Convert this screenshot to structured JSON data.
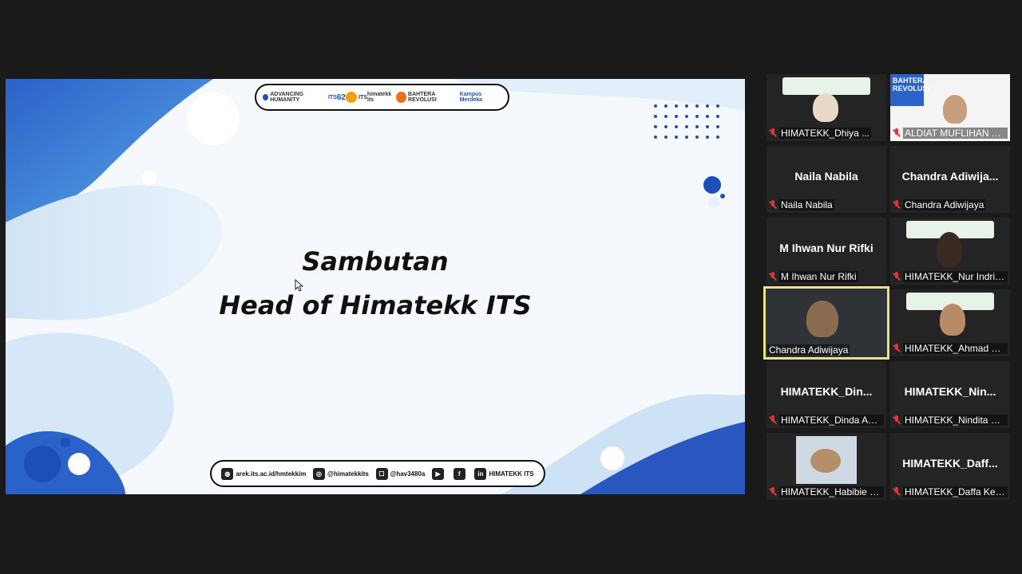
{
  "slide": {
    "title_line1": "Sambutan",
    "title_line2": "Head of Himatekk ITS",
    "logos": [
      "ADVANCING HUMANITY",
      "ITS",
      "62",
      "ITS",
      "himatekk its",
      "BAHTERA REVOLUSI",
      "Kampus Merdeka"
    ],
    "footer": [
      {
        "icon": "globe-icon",
        "text": "arek.its.ac.id/hmtekkim"
      },
      {
        "icon": "instagram-icon",
        "text": "@himatekkits"
      },
      {
        "icon": "line-icon",
        "text": "@hav3480a"
      },
      {
        "icon": "youtube-icon",
        "text": ""
      },
      {
        "icon": "facebook-icon",
        "text": ""
      },
      {
        "icon": "linkedin-icon",
        "text": "HIMATEKK ITS"
      }
    ]
  },
  "participants": [
    {
      "center": "",
      "label": "HIMATEKK_Dhiya ...",
      "video": true
    },
    {
      "center": "",
      "label": "ALDIAT MUFLIHAN TS...",
      "video": true
    },
    {
      "center": "Naila Nabila",
      "label": "Naila Nabila",
      "video": false
    },
    {
      "center": "Chandra  Adiwija...",
      "label": "Chandra Adiwijaya",
      "video": false
    },
    {
      "center": "M Ihwan Nur Rifki",
      "label": "M Ihwan Nur Rifki",
      "video": false
    },
    {
      "center": "",
      "label": "HIMATEKK_Nur Indria...",
      "video": true
    },
    {
      "center": "",
      "label": "Chandra Adiwijaya",
      "video": true,
      "active": true
    },
    {
      "center": "",
      "label": "HIMATEKK_Ahmad Ch...",
      "video": true
    },
    {
      "center": "HIMATEKK_Din...",
      "label": "HIMATEKK_Dinda Am...",
      "video": false
    },
    {
      "center": "HIMATEKK_Nin...",
      "label": "HIMATEKK_Nindita W...",
      "video": false
    },
    {
      "center": "",
      "label": "HIMATEKK_Habibie d...",
      "video": true
    },
    {
      "center": "HIMATEKK_Daff...",
      "label": "HIMATEKK_Daffa Kevi...",
      "video": false
    }
  ],
  "colors": {
    "accent_blue": "#1e4fb8",
    "active_outline": "#e9e28a",
    "muted_red": "#d9363e"
  }
}
